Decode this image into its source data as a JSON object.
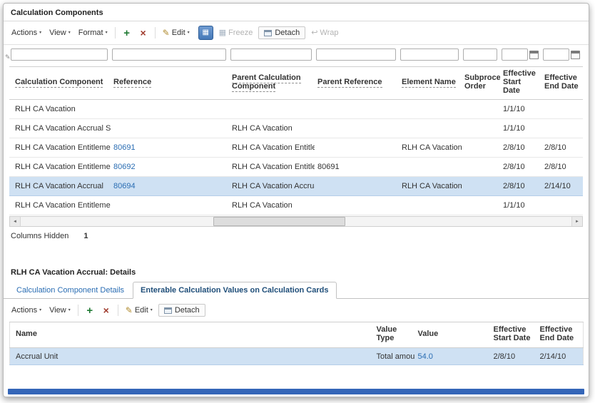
{
  "colors": {
    "link": "#2a6db3",
    "selected_row": "#cfe1f3",
    "qbe_button": "#4679b8",
    "bottom_bar": "#3566b8"
  },
  "components_panel": {
    "title": "Calculation Components",
    "toolbar": {
      "actions": "Actions",
      "view": "View",
      "format": "Format",
      "edit": "Edit",
      "freeze": "Freeze",
      "detach": "Detach",
      "wrap": "Wrap"
    },
    "table": {
      "columns": [
        "Calculation Component",
        "Reference",
        "Parent Calculation Component",
        "Parent Reference",
        "Element Name",
        "Subprocessing Order",
        "Effective Start Date",
        "Effective End Date"
      ],
      "link_columns": [
        1
      ],
      "rows": [
        {
          "cells": [
            "RLH CA Vacation",
            "",
            "",
            "",
            "",
            "",
            "1/1/10",
            ""
          ],
          "selected": false
        },
        {
          "cells": [
            "RLH CA Vacation Accrual Summary",
            "",
            "RLH CA Vacation",
            "",
            "",
            "",
            "1/1/10",
            ""
          ],
          "selected": false
        },
        {
          "cells": [
            "RLH CA Vacation Entitlement",
            "80691",
            "RLH CA Vacation Entitlement Summary",
            "",
            "RLH CA Vacation Entitlement",
            "",
            "2/8/10",
            "2/8/10"
          ],
          "selected": false
        },
        {
          "cells": [
            "RLH CA Vacation Entitlement Date",
            "80692",
            "RLH CA Vacation Entitlement",
            "80691",
            "",
            "",
            "2/8/10",
            "2/8/10"
          ],
          "selected": false
        },
        {
          "cells": [
            "RLH CA Vacation Accrual",
            "80694",
            "RLH CA Vacation Accrual Summary",
            "",
            "RLH CA Vacation Accrual",
            "",
            "2/8/10",
            "2/14/10"
          ],
          "selected": true
        },
        {
          "cells": [
            "RLH CA Vacation Entitlement Summary",
            "",
            "RLH CA Vacation",
            "",
            "",
            "",
            "1/1/10",
            ""
          ],
          "selected": false
        }
      ]
    },
    "columns_hidden": {
      "label": "Columns Hidden",
      "count": "1"
    }
  },
  "details_panel": {
    "title": "RLH CA Vacation Accrual: Details",
    "tabs": [
      {
        "label": "Calculation Component Details",
        "selected": false
      },
      {
        "label": "Enterable Calculation Values on Calculation Cards",
        "selected": true
      }
    ],
    "toolbar": {
      "actions": "Actions",
      "view": "View",
      "edit": "Edit",
      "detach": "Detach"
    },
    "table": {
      "columns": [
        "Name",
        "Value Type",
        "Value",
        "Effective Start Date",
        "Effective End Date"
      ],
      "link_columns": [
        2
      ],
      "rows": [
        {
          "cells": [
            "Accrual Unit",
            "Total amount",
            "54.0",
            "2/8/10",
            "2/14/10"
          ],
          "selected": true
        }
      ]
    }
  }
}
